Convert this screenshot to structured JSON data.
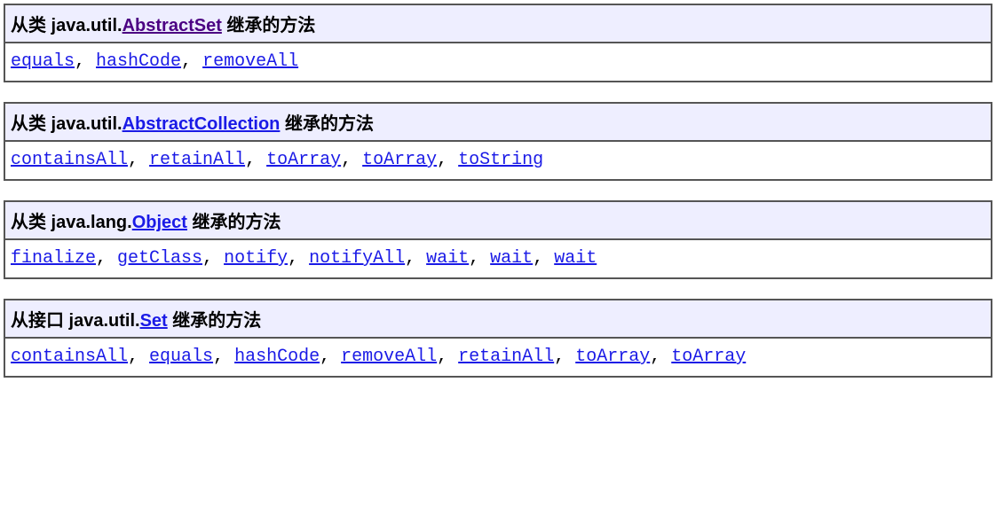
{
  "groups": [
    {
      "prefix": "从类 java.util.",
      "class_name": "AbstractSet",
      "link_color": "purple",
      "suffix": " 继承的方法",
      "methods": [
        "equals",
        "hashCode",
        "removeAll"
      ]
    },
    {
      "prefix": "从类 java.util.",
      "class_name": "AbstractCollection",
      "link_color": "blue",
      "suffix": " 继承的方法",
      "methods": [
        "containsAll",
        "retainAll",
        "toArray",
        "toArray",
        "toString"
      ]
    },
    {
      "prefix": "从类 java.lang.",
      "class_name": "Object",
      "link_color": "blue",
      "suffix": " 继承的方法",
      "methods": [
        "finalize",
        "getClass",
        "notify",
        "notifyAll",
        "wait",
        "wait",
        "wait"
      ]
    },
    {
      "prefix": "从接口 java.util.",
      "class_name": "Set",
      "link_color": "blue",
      "suffix": " 继承的方法",
      "methods": [
        "containsAll",
        "equals",
        "hashCode",
        "removeAll",
        "retainAll",
        "toArray",
        "toArray"
      ]
    }
  ],
  "separator": ", "
}
